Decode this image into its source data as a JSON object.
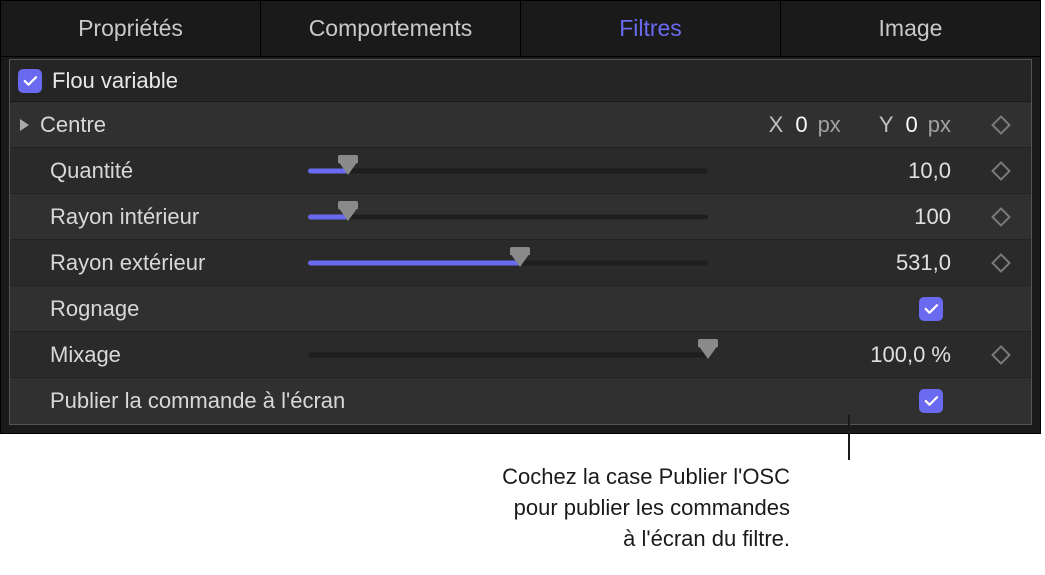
{
  "tabs": {
    "properties": "Propriétés",
    "behaviors": "Comportements",
    "filters": "Filtres",
    "image": "Image"
  },
  "filter": {
    "name": "Flou variable",
    "params": {
      "centre": {
        "label": "Centre",
        "x_label": "X",
        "x_value": "0",
        "x_unit": "px",
        "y_label": "Y",
        "y_value": "0",
        "y_unit": "px"
      },
      "quantite": {
        "label": "Quantité",
        "value": "10,0",
        "slider_pct": 10
      },
      "rayon_int": {
        "label": "Rayon intérieur",
        "value": "100",
        "slider_pct": 10
      },
      "rayon_ext": {
        "label": "Rayon extérieur",
        "value": "531,0",
        "slider_pct": 53
      },
      "rognage": {
        "label": "Rognage",
        "checked": true
      },
      "mixage": {
        "label": "Mixage",
        "value": "100,0 %",
        "slider_pct": 100
      },
      "publier": {
        "label": "Publier la commande à l'écran",
        "checked": true
      }
    }
  },
  "annotation": {
    "line1": "Cochez la case Publier l'OSC",
    "line2": "pour publier les commandes",
    "line3": "à l'écran du filtre."
  }
}
